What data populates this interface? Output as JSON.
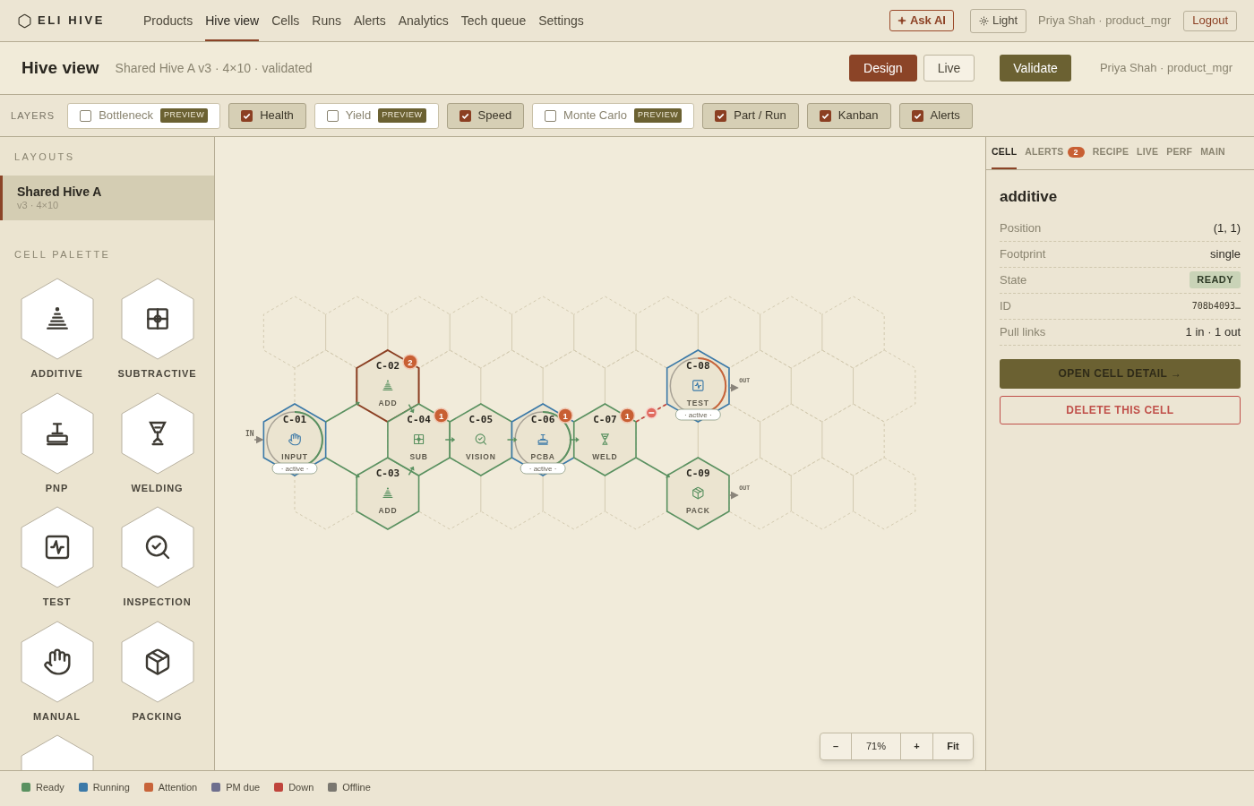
{
  "brand": "ELI HIVE",
  "nav": [
    {
      "label": "Products",
      "selected": false
    },
    {
      "label": "Hive view",
      "selected": true
    },
    {
      "label": "Cells",
      "selected": false
    },
    {
      "label": "Runs",
      "selected": false
    },
    {
      "label": "Alerts",
      "selected": false
    },
    {
      "label": "Analytics",
      "selected": false
    },
    {
      "label": "Tech queue",
      "selected": false
    },
    {
      "label": "Settings",
      "selected": false
    }
  ],
  "header_actions": {
    "ask_ai": "Ask AI",
    "theme": "Light",
    "user": "Priya Shah · product_mgr",
    "logout": "Logout"
  },
  "page": {
    "title": "Hive view",
    "subtitle": "Shared Hive A v3 · 4×10 · validated",
    "modes": [
      {
        "label": "Design",
        "selected": true
      },
      {
        "label": "Live",
        "selected": false
      }
    ],
    "validate": "Validate",
    "user": "Priya Shah · product_mgr"
  },
  "layers": {
    "label": "LAYERS",
    "items": [
      {
        "label": "Bottleneck",
        "checked": false,
        "badge": "PREVIEW"
      },
      {
        "label": "Health",
        "checked": true
      },
      {
        "label": "Yield",
        "checked": false,
        "badge": "PREVIEW"
      },
      {
        "label": "Speed",
        "checked": true
      },
      {
        "label": "Monte Carlo",
        "checked": false,
        "badge": "PREVIEW"
      },
      {
        "label": "Part / Run",
        "checked": true
      },
      {
        "label": "Kanban",
        "checked": true
      },
      {
        "label": "Alerts",
        "checked": true
      }
    ]
  },
  "sidebar": {
    "layouts_title": "LAYOUTS",
    "layouts": [
      {
        "name": "Shared Hive A",
        "meta": "v3 · 4×10",
        "selected": true
      }
    ],
    "palette_title": "CELL PALETTE",
    "palette": [
      {
        "kind": "additive",
        "label": "ADDITIVE"
      },
      {
        "kind": "subtractive",
        "label": "SUBTRACTIVE"
      },
      {
        "kind": "pnp",
        "label": "PNP"
      },
      {
        "kind": "welding",
        "label": "WELDING"
      },
      {
        "kind": "test",
        "label": "TEST"
      },
      {
        "kind": "vision",
        "label": "INSPECTION"
      },
      {
        "kind": "manual",
        "label": "MANUAL"
      },
      {
        "kind": "packing",
        "label": "PACKING"
      },
      {
        "kind": "route"
      }
    ]
  },
  "hive": {
    "entry": "IN",
    "cells": [
      {
        "id": "C-01",
        "label": "INPUT",
        "kind": "manual",
        "running": true,
        "selected": false,
        "ring": true,
        "attention": false,
        "tag": "· active ·"
      },
      {
        "id": "C-02",
        "label": "ADD",
        "kind": "additive",
        "running": false,
        "selected": true,
        "alerts": "2"
      },
      {
        "id": "C-03",
        "label": "ADD",
        "kind": "additive",
        "running": false,
        "selected": false
      },
      {
        "id": "C-04",
        "label": "SUB",
        "kind": "subtractive",
        "running": false,
        "selected": false,
        "alerts": "1"
      },
      {
        "id": "C-05",
        "label": "VISION",
        "kind": "vision",
        "running": false,
        "selected": false
      },
      {
        "id": "C-06",
        "label": "PCBA",
        "kind": "pnp",
        "running": true,
        "selected": false,
        "ring": true,
        "attention": false,
        "tag": "· active ·",
        "alerts": "1"
      },
      {
        "id": "C-07",
        "label": "WELD",
        "kind": "welding",
        "running": false,
        "selected": false,
        "alerts": "1"
      },
      {
        "id": "C-08",
        "label": "TEST",
        "kind": "test",
        "running": true,
        "selected": false,
        "ring": true,
        "attention": true,
        "tag": "· active ·",
        "exit": "OUT"
      },
      {
        "id": "C-09",
        "label": "PACK",
        "kind": "packing",
        "running": false,
        "selected": false,
        "exit": "OUT"
      }
    ],
    "links": [
      {
        "broken": false
      },
      {
        "broken": false
      },
      {
        "broken": false
      },
      {
        "broken": false
      },
      {
        "broken": false
      },
      {
        "broken": false
      },
      {
        "broken": false
      },
      {
        "broken": true
      },
      {
        "broken": false
      }
    ]
  },
  "zoom": {
    "out": "–",
    "level": "71%",
    "in": "+",
    "fit": "Fit"
  },
  "inspector": {
    "tabs": [
      {
        "label": "CELL",
        "selected": true
      },
      {
        "label": "ALERTS",
        "selected": false,
        "badge": "2"
      },
      {
        "label": "RECIPE",
        "selected": false
      },
      {
        "label": "LIVE",
        "selected": false
      },
      {
        "label": "PERF",
        "selected": false
      },
      {
        "label": "MAIN",
        "selected": false
      }
    ],
    "title": "additive",
    "fields": [
      {
        "label": "Position",
        "value": "(1, 1)",
        "kind": "text"
      },
      {
        "label": "Footprint",
        "value": "single",
        "kind": "text"
      },
      {
        "label": "State",
        "value": "READY",
        "kind": "badge"
      },
      {
        "label": "ID",
        "value": "708b4093…",
        "kind": "code"
      },
      {
        "label": "Pull links",
        "value": "1 in · 1 out",
        "kind": "text"
      }
    ],
    "open": "OPEN CELL DETAIL →",
    "delete": "DELETE THIS CELL"
  },
  "legend": [
    {
      "label": "Ready",
      "color": "#5a9160"
    },
    {
      "label": "Running",
      "color": "#3b79a8"
    },
    {
      "label": "Attention",
      "color": "#c8643a"
    },
    {
      "label": "PM due",
      "color": "#6e6f8e"
    },
    {
      "label": "Down",
      "color": "#c0443c"
    },
    {
      "label": "Offline",
      "color": "#7a7770"
    }
  ]
}
